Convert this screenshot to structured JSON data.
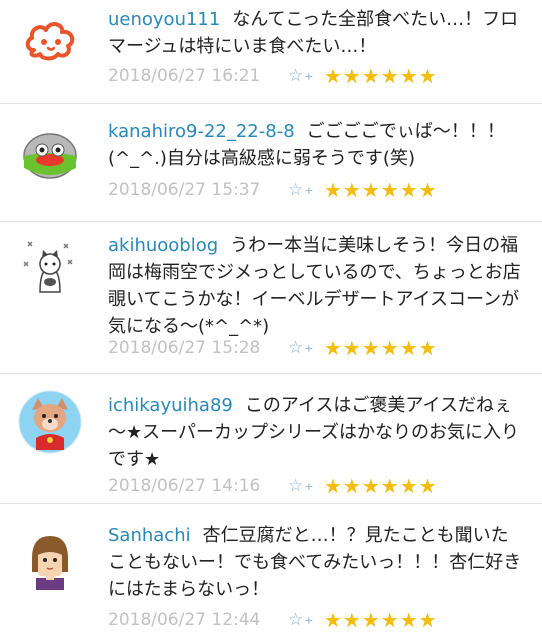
{
  "comments": [
    {
      "user": "uenoyou111",
      "text": "なんてこった全部食べたい…！フロマージュは特にいま食べたい…！",
      "timestamp": "2018/06/27 16:21",
      "stars": "★★★★★★"
    },
    {
      "user": "kanahiro9-22_22-8-8",
      "text": "ごごごごでぃば～！！！(^_^.)自分は高級感に弱そうです(笑)",
      "timestamp": "2018/06/27 15:37",
      "stars": "★★★★★★"
    },
    {
      "user": "akihuooblog",
      "text": "うわー本当に美味しそう！今日の福岡は梅雨空でジメっとしているので、ちょっとお店覗いてこうかな！イーベルデザートアイスコーンが気になる～(*^_^*)",
      "timestamp": "2018/06/27 15:28",
      "stars": "★★★★★★"
    },
    {
      "user": "ichikayuiha89",
      "text": "このアイスはご褒美アイスだねぇ～★スーパーカップシリーズはかなりのお気に入りです★",
      "timestamp": "2018/06/27 14:16",
      "stars": "★★★★★★"
    },
    {
      "user": "Sanhachi",
      "text": "杏仁豆腐だと…！？見たことも聞いたこともないー！でも食べてみたいっ！！！杏仁好きにはたまらないっ！",
      "timestamp": "2018/06/27 12:44",
      "stars": "★★★★★★"
    }
  ],
  "add_star_icon": "☆",
  "add_star_plus": "+",
  "colors": {
    "username": "#2a88b8",
    "timestamp": "#c2c2c2",
    "star": "#f3bc0b",
    "add_star": "#8db2dc",
    "divider": "#e2e2e2"
  }
}
